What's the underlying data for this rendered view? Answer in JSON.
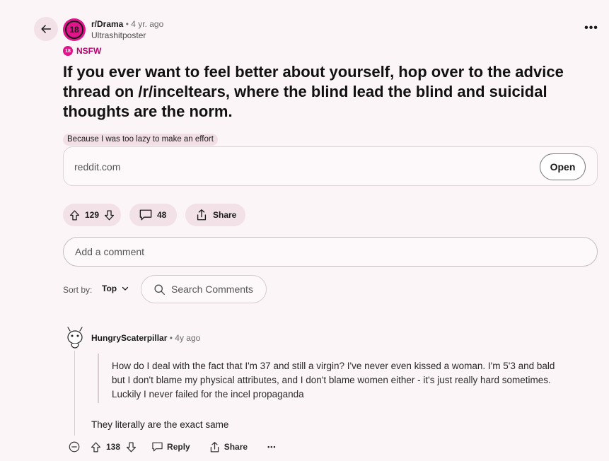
{
  "header": {
    "subreddit": "r/Drama",
    "separator": "•",
    "age": "4 yr. ago",
    "author": "Ultrashitposter",
    "subreddit_avatar_text": "18",
    "more_label": "•••"
  },
  "nsfw": {
    "badge": "18",
    "label": "NSFW"
  },
  "post": {
    "title": "If you ever want to feel better about yourself, hop over to the advice thread on /r/inceltears, where the blind lead the blind and suicidal thoughts are the norm.",
    "flair": "Because I was too lazy to make an effort",
    "link_domain": "reddit.com",
    "open_label": "Open"
  },
  "actions": {
    "score": "129",
    "comments": "48",
    "share_label": "Share"
  },
  "comment_input": {
    "placeholder": "Add a comment"
  },
  "sort": {
    "label": "Sort by:",
    "value": "Top",
    "search_placeholder": "Search Comments"
  },
  "comment": {
    "user": "HungryScaterpillar",
    "separator": "•",
    "age": "4y ago",
    "quote_lines": [
      "How do I deal with the fact that I'm 37 and still a virgin? I've never even kissed a woman. I'm 5'3 and bald",
      "but I don't blame my physical attributes, and I don't blame women either - it's just really hard sometimes.",
      "Luckily I never failed for the incel propaganda"
    ],
    "body": "They literally are the exact same",
    "score": "138",
    "reply_label": "Reply",
    "share_label": "Share",
    "more_label": "•••"
  },
  "colors": {
    "background": "#fcf5f7",
    "pill": "#f2e1e7",
    "nsfw": "#e0158a"
  }
}
